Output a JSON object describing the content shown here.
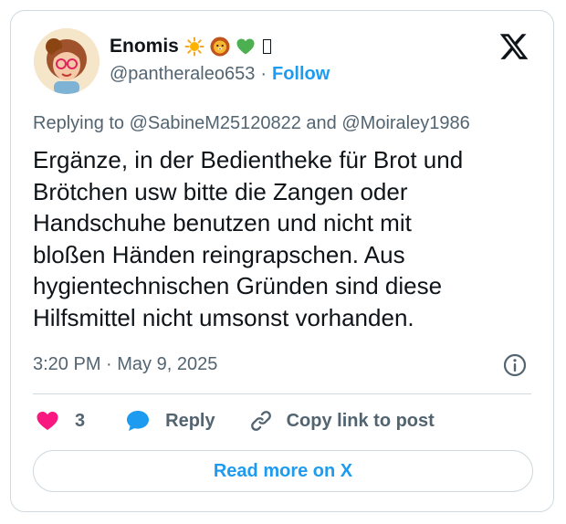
{
  "author": {
    "display_name": "Enomis",
    "emojis": [
      "sun-emoji",
      "lion-emoji",
      "green-heart-emoji",
      "missing-glyph"
    ],
    "handle": "@pantheraleo653",
    "separator": "·",
    "follow_label": "Follow"
  },
  "reply_context": {
    "prefix": "Replying to",
    "mention_1": "@SabineM25120822",
    "conjunction": "and",
    "mention_2": "@Moiraley1986"
  },
  "tweet": {
    "text": "Ergänze, in der Bedientheke für Brot und\nBrötchen usw bitte die Zangen oder\nHandschuhe benutzen und nicht mit\nbloßen Händen reingrapschen. Aus\nhygientechnischen Gründen sind diese\nHilfsmittel nicht umsonst vorhanden.",
    "timestamp": "3:20 PM · May 9, 2025"
  },
  "actions": {
    "like_count": "3",
    "reply_label": "Reply",
    "copy_link_label": "Copy link to post"
  },
  "footer": {
    "read_more_label": "Read more on X"
  },
  "icons": {
    "brand": "x-logo-icon",
    "info": "info-icon",
    "like": "heart-icon",
    "reply": "speech-bubble-icon",
    "copy": "link-icon"
  },
  "colors": {
    "accent": "#1d9bf0",
    "like": "#f91880",
    "text": "#0f1419",
    "secondary": "#536471",
    "border": "#cfd9de"
  }
}
